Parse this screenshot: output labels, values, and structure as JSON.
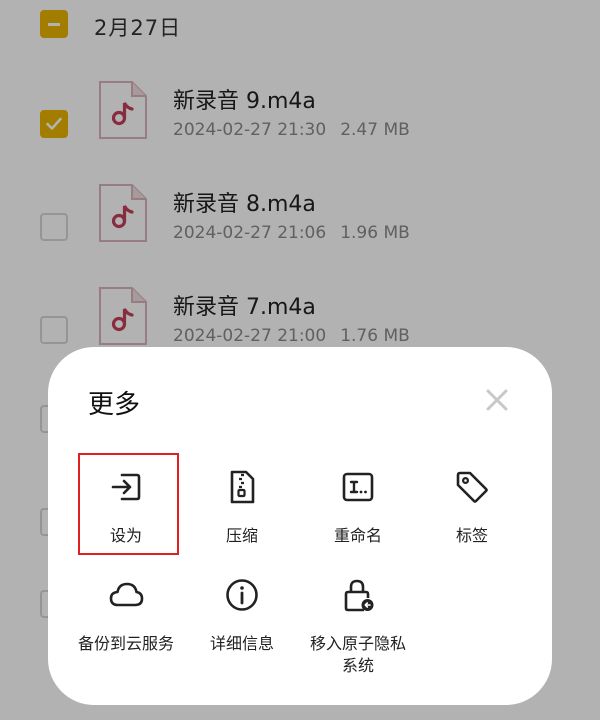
{
  "list": {
    "date_group": "2月27日",
    "files": [
      {
        "name": "新录音 9.m4a",
        "date": "2024-02-27 21:30",
        "size": "2.47 MB",
        "checked": true
      },
      {
        "name": "新录音 8.m4a",
        "date": "2024-02-27 21:06",
        "size": "1.96 MB",
        "checked": false
      },
      {
        "name": "新录音 7.m4a",
        "date": "2024-02-27 21:00",
        "size": "1.76 MB",
        "checked": false
      }
    ]
  },
  "sheet": {
    "title": "更多",
    "actions": [
      {
        "label": "设为",
        "icon": "set-as-icon"
      },
      {
        "label": "压缩",
        "icon": "zip-icon"
      },
      {
        "label": "重命名",
        "icon": "rename-icon"
      },
      {
        "label": "标签",
        "icon": "tag-icon"
      },
      {
        "label": "备份到云服务",
        "icon": "cloud-icon"
      },
      {
        "label": "详细信息",
        "icon": "info-icon"
      },
      {
        "label": "移入原子隐私系统",
        "icon": "lock-icon"
      }
    ]
  },
  "colors": {
    "accent": "#e8b400",
    "file_icon": "#c2415a",
    "highlight": "#e02020",
    "scrim": "rgba(0,0,0,0.3)"
  }
}
